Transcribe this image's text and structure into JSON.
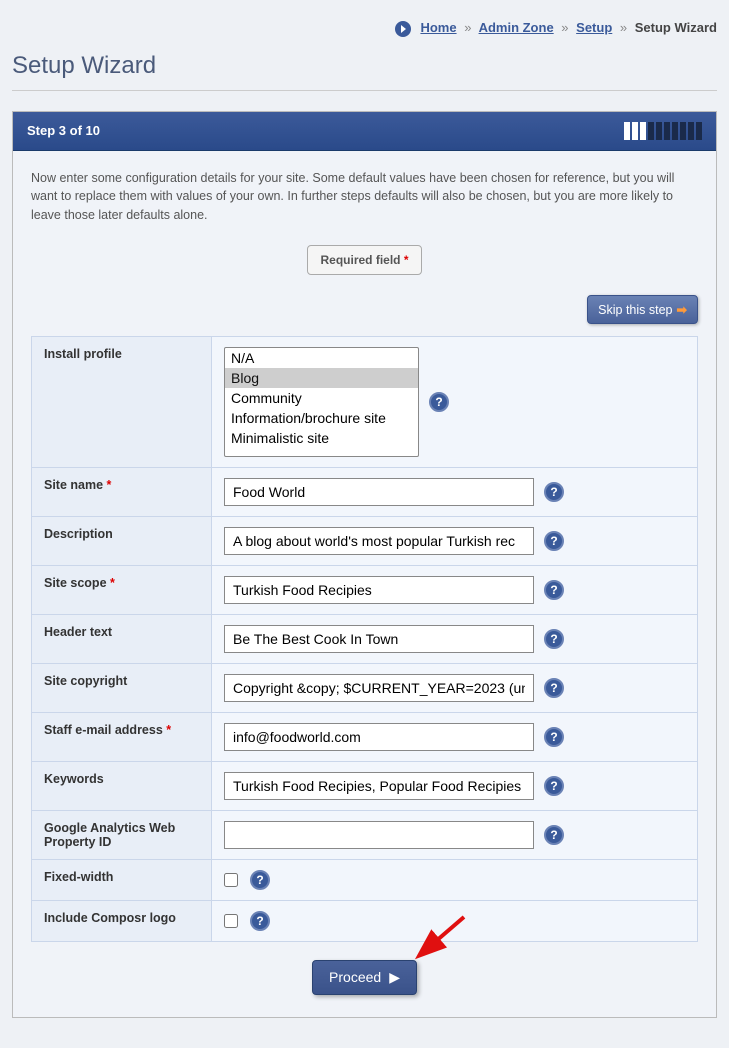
{
  "breadcrumb": {
    "home": "Home",
    "admin_zone": "Admin Zone",
    "setup": "Setup",
    "current": "Setup Wizard"
  },
  "page_title": "Setup Wizard",
  "step_label": "Step 3 of 10",
  "progress": {
    "current": 3,
    "total": 10
  },
  "intro": "Now enter some configuration details for your site. Some default values have been chosen for reference, but you will want to replace them with values of your own. In further steps defaults will also be chosen, but you are more likely to leave those later defaults alone.",
  "required_badge": "Required field",
  "skip_label": "Skip this step",
  "fields": {
    "install_profile": {
      "label": "Install profile",
      "options": [
        "N/A",
        "Blog",
        "Community",
        "Information/brochure site",
        "Minimalistic site"
      ],
      "selected": "Blog"
    },
    "site_name": {
      "label": "Site name",
      "required": true,
      "value": "Food World"
    },
    "description": {
      "label": "Description",
      "required": false,
      "value": "A blog about world's most popular Turkish rec"
    },
    "site_scope": {
      "label": "Site scope",
      "required": true,
      "value": "Turkish Food Recipies"
    },
    "header_text": {
      "label": "Header text",
      "required": false,
      "value": "Be The Best Cook In Town"
    },
    "site_copyright": {
      "label": "Site copyright",
      "required": false,
      "value": "Copyright &copy; $CURRENT_YEAR=2023 (unr"
    },
    "staff_email": {
      "label": "Staff e-mail address",
      "required": true,
      "value": "info@foodworld.com"
    },
    "keywords": {
      "label": "Keywords",
      "required": false,
      "value": "Turkish Food Recipies, Popular Food Recipies"
    },
    "ga_id": {
      "label": "Google Analytics Web Property ID",
      "required": false,
      "value": ""
    },
    "fixed_width": {
      "label": "Fixed-width",
      "checked": false
    },
    "include_logo": {
      "label": "Include Composr logo",
      "checked": false
    }
  },
  "proceed_label": "Proceed"
}
